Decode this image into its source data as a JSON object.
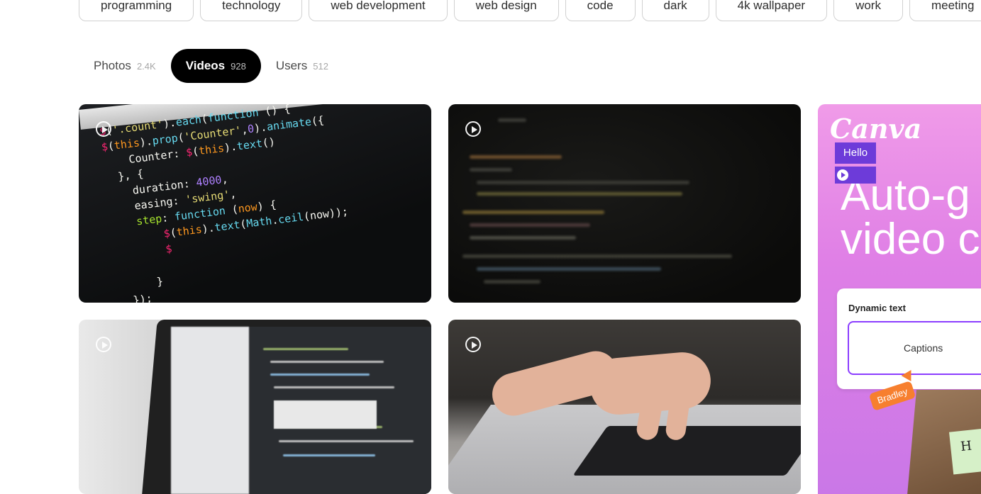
{
  "chips": [
    "programming",
    "technology",
    "web development",
    "web design",
    "code",
    "dark",
    "4k wallpaper",
    "work",
    "meeting"
  ],
  "tabs": [
    {
      "label": "Photos",
      "count": "2.4K"
    },
    {
      "label": "Videos",
      "count": "928"
    },
    {
      "label": "Users",
      "count": "512"
    }
  ],
  "active_tab": "Videos",
  "ad": {
    "brand": "Canva",
    "headline_line1": "Auto-g",
    "headline_line2": "video c",
    "card_title": "Dynamic text",
    "hello": "Hello",
    "captions": "Captions",
    "name_tag": "Bradley",
    "note": "H"
  }
}
